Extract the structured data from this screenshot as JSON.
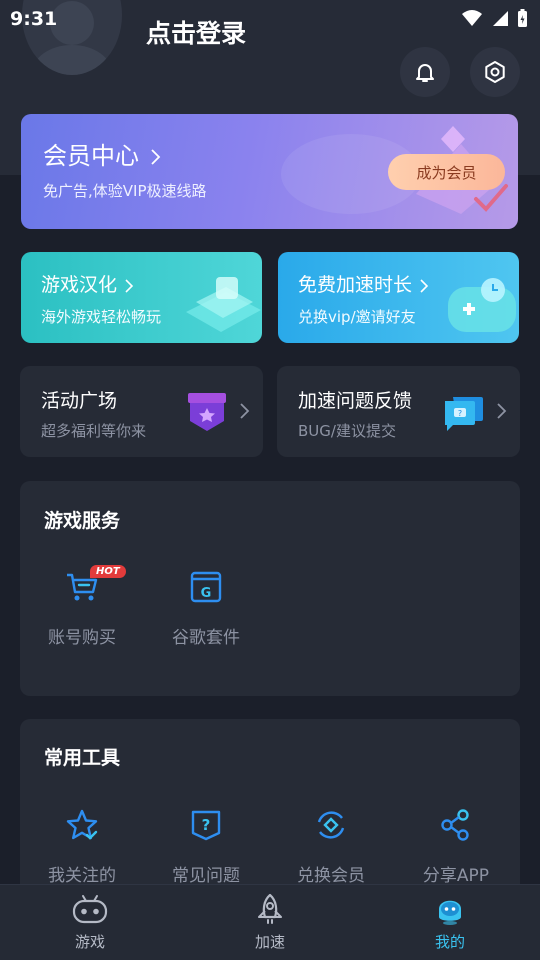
{
  "status_bar": {
    "time": "9:31"
  },
  "header": {
    "login_text": "点击登录",
    "bell_icon": "bell-icon",
    "settings_icon": "settings-icon"
  },
  "vip_banner": {
    "title": "会员中心",
    "subtitle": "免广告,体验VIP极速线路",
    "button": "成为会员"
  },
  "feature_cards": [
    {
      "title": "游戏汉化",
      "subtitle": "海外游戏轻松畅玩",
      "color": "#2ec3c9"
    },
    {
      "title": "免费加速时长",
      "subtitle": "兑换vip/邀请好友",
      "color": "#2fb5ea"
    }
  ],
  "info_cards": [
    {
      "title": "活动广场",
      "subtitle": "超多福利等你来"
    },
    {
      "title": "加速问题反馈",
      "subtitle": "BUG/建议提交"
    }
  ],
  "game_services": {
    "title": "游戏服务",
    "hot_badge": "HOT",
    "items": [
      {
        "label": "账号购买",
        "icon": "cart-icon"
      },
      {
        "label": "谷歌套件",
        "icon": "google-suite-icon"
      }
    ]
  },
  "tools": {
    "title": "常用工具",
    "items": [
      {
        "label": "我关注的",
        "icon": "star-icon"
      },
      {
        "label": "常见问题",
        "icon": "question-icon"
      },
      {
        "label": "兑换会员",
        "icon": "exchange-icon"
      },
      {
        "label": "分享APP",
        "icon": "share-icon"
      }
    ]
  },
  "bottom_nav": [
    {
      "label": "游戏",
      "icon": "gamepad-icon",
      "active": false
    },
    {
      "label": "加速",
      "icon": "rocket-icon",
      "active": false
    },
    {
      "label": "我的",
      "icon": "profile-icon",
      "active": true
    }
  ],
  "colors": {
    "background": "#1b1f2a",
    "card": "#262b36",
    "accent": "#3ac3f0",
    "icon_blue": "#2e8ef0"
  }
}
